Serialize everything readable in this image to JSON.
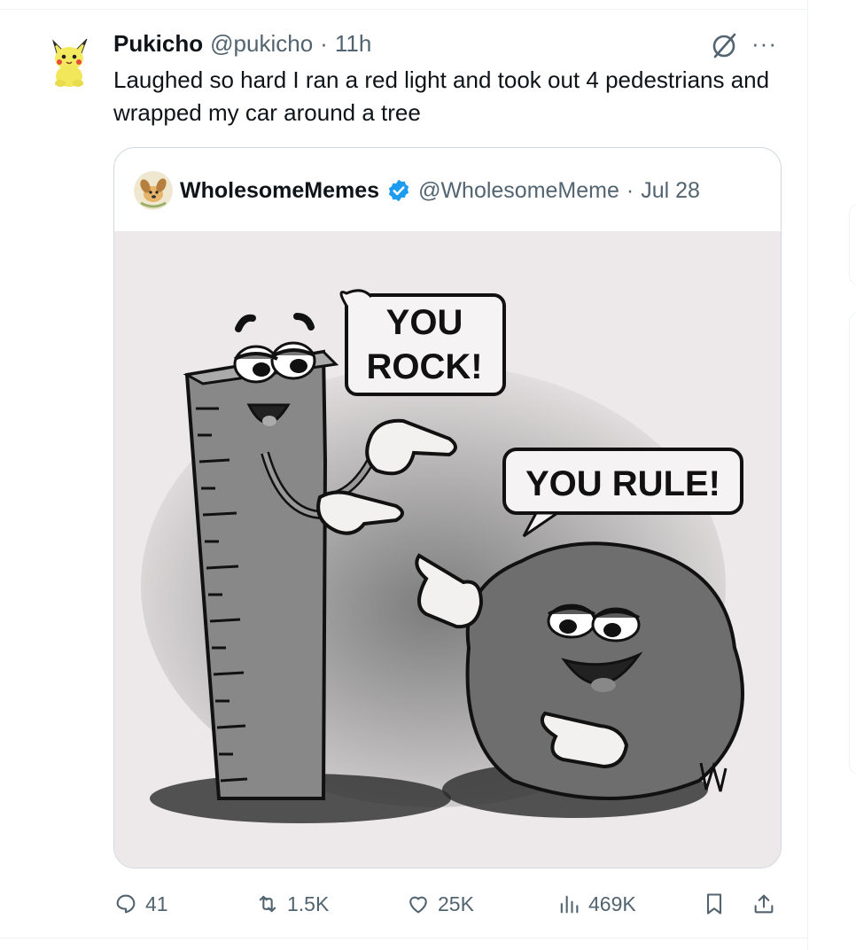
{
  "tweet": {
    "author_name": "Pukicho",
    "handle": "@pukicho",
    "separator": "·",
    "time": "11h",
    "text": "Laughed so hard I ran a red light and took out 4 pedestrians and wrapped my car around a tree",
    "avatar_icon": "pikachu-plush-avatar",
    "grok_icon": "grok-icon",
    "more_label": "···"
  },
  "quote": {
    "author_name": "WholesomeMemes",
    "handle": "@WholesomeMeme",
    "separator": "·",
    "date": "Jul 28",
    "verified_icon": "verified-badge-icon",
    "verified_color": "#1d9bf0",
    "image": {
      "description_icon": "ruler-and-rock-meme",
      "bubble_left": "YOU ROCK!",
      "bubble_left_line1": "YOU",
      "bubble_left_line2": "ROCK!",
      "bubble_right": "YOU RULE!"
    }
  },
  "actions": {
    "replies": "41",
    "reposts": "1.5K",
    "likes": "25K",
    "views": "469K",
    "reply_icon": "reply-icon",
    "repost_icon": "repost-icon",
    "like_icon": "heart-icon",
    "views_icon": "views-chart-icon",
    "bookmark_icon": "bookmark-icon",
    "share_icon": "share-icon"
  },
  "colors": {
    "text_primary": "#0f1419",
    "text_secondary": "#536471",
    "border": "#cfd9de",
    "verified": "#1d9bf0"
  }
}
